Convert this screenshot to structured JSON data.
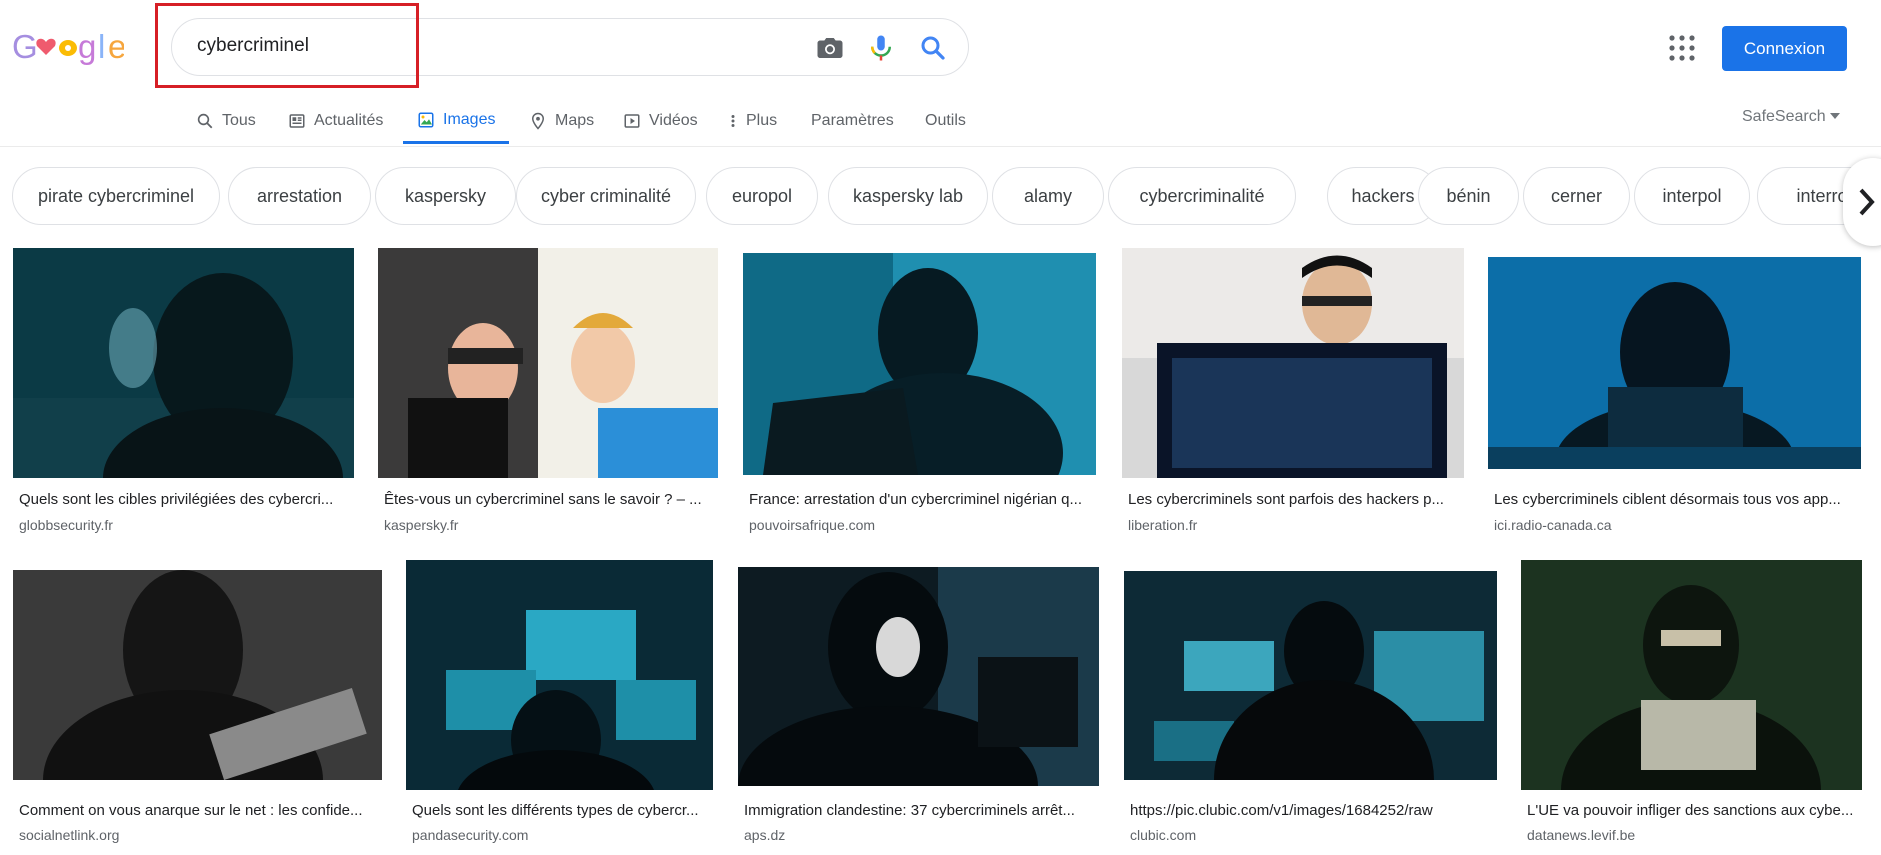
{
  "logo": {
    "text": "Google",
    "colors": [
      "#a58ee0",
      "#ef5b6e",
      "#fbbc05",
      "#8ab4f8",
      "#c67ad8",
      "#f6a63e"
    ]
  },
  "search": {
    "query": "cybercriminel"
  },
  "header": {
    "login_label": "Connexion"
  },
  "tabs": [
    {
      "label": "Tous",
      "icon": "search-icon"
    },
    {
      "label": "Actualités",
      "icon": "news-icon"
    },
    {
      "label": "Images",
      "icon": "image-icon",
      "active": true
    },
    {
      "label": "Maps",
      "icon": "map-pin-icon"
    },
    {
      "label": "Vidéos",
      "icon": "play-icon"
    },
    {
      "label": "Plus",
      "icon": "more-vert-icon"
    },
    {
      "label": "Paramètres"
    },
    {
      "label": "Outils"
    }
  ],
  "safesearch": {
    "label": "SafeSearch"
  },
  "chips": [
    "pirate cybercriminel",
    "arrestation",
    "kaspersky",
    "cyber criminalité",
    "europol",
    "kaspersky lab",
    "alamy",
    "cybercriminalité",
    "hackers",
    "bénin",
    "cerner",
    "interpol",
    "interrog"
  ],
  "results": [
    {
      "title": "Quels sont les cibles privilégiées des cybercri...",
      "site": "globbsecurity.fr"
    },
    {
      "title": "Êtes-vous un cybercriminel sans le savoir ? – ...",
      "site": "kaspersky.fr"
    },
    {
      "title": "France: arrestation d'un cybercriminel nigérian q...",
      "site": "pouvoirsafrique.com"
    },
    {
      "title": "Les cybercriminels sont parfois des hackers p...",
      "site": "liberation.fr"
    },
    {
      "title": "Les cybercriminels ciblent désormais tous vos app...",
      "site": "ici.radio-canada.ca"
    },
    {
      "title": "Comment on vous anarque sur le net : les confide...",
      "site": "socialnetlink.org"
    },
    {
      "title": "Quels sont les différents types de cybercr...",
      "site": "pandasecurity.com"
    },
    {
      "title": "Immigration clandestine: 37 cybercriminels arrêt...",
      "site": "aps.dz"
    },
    {
      "title": "https://pic.clubic.com/v1/images/1684252/raw",
      "site": "clubic.com"
    },
    {
      "title": "L'UE va pouvoir infliger des sanctions aux cybe...",
      "site": "datanews.levif.be"
    }
  ],
  "colors": {
    "accent": "#1a73e8",
    "highlight_box": "#d61f26"
  }
}
